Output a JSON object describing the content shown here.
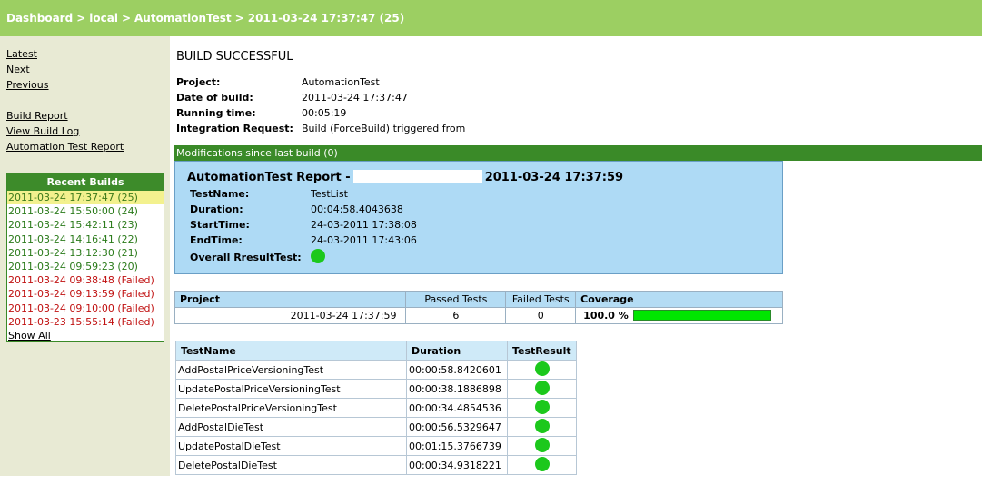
{
  "breadcrumb": {
    "dashboard": "Dashboard",
    "separator": ">",
    "server": "local",
    "project": "AutomationTest",
    "build": "2011-03-24 17:37:47 (25)"
  },
  "sidebar": {
    "nav": [
      "Latest",
      "Next",
      "Previous"
    ],
    "reports": [
      "Build Report",
      "View Build Log",
      "Automation Test Report"
    ],
    "recent_title": "Recent Builds",
    "recent_builds": [
      {
        "label": "2011-03-24 17:37:47 (25)",
        "state": "current"
      },
      {
        "label": "2011-03-24 15:50:00 (24)",
        "state": "ok"
      },
      {
        "label": "2011-03-24 15:42:11 (23)",
        "state": "ok"
      },
      {
        "label": "2011-03-24 14:16:41 (22)",
        "state": "ok"
      },
      {
        "label": "2011-03-24 13:12:30 (21)",
        "state": "ok"
      },
      {
        "label": "2011-03-24 09:59:23 (20)",
        "state": "ok"
      },
      {
        "label": "2011-03-24 09:38:48 (Failed)",
        "state": "fail"
      },
      {
        "label": "2011-03-24 09:13:59 (Failed)",
        "state": "fail"
      },
      {
        "label": "2011-03-24 09:10:00 (Failed)",
        "state": "fail"
      },
      {
        "label": "2011-03-23 15:55:14 (Failed)",
        "state": "fail"
      }
    ],
    "show_all": "Show All"
  },
  "build": {
    "status": "BUILD SUCCESSFUL",
    "project_label": "Project:",
    "project": "AutomationTest",
    "date_label": "Date of build:",
    "date": "2011-03-24 17:37:47",
    "running_label": "Running time:",
    "running": "00:05:19",
    "request_label": "Integration Request:",
    "request": "Build (ForceBuild) triggered from"
  },
  "modifications": "Modifications since last build (0)",
  "report": {
    "title_prefix": "AutomationTest Report -",
    "title_date": "2011-03-24 17:37:59",
    "testname_label": "TestName:",
    "testname": "TestList",
    "duration_label": "Duration:",
    "duration": "00:04:58.4043638",
    "start_label": "StartTime:",
    "start": "24-03-2011 17:38:08",
    "end_label": "EndTime:",
    "end": "24-03-2011 17:43:06",
    "overall_label": "Overall RresultTest:",
    "overall_status": "passed"
  },
  "coverage_table": {
    "headers": [
      "Project",
      "Passed Tests",
      "Failed Tests",
      "Coverage"
    ],
    "row": {
      "date": "2011-03-24 17:37:59",
      "passed": "6",
      "failed": "0",
      "coverage": "100.0 %",
      "coverage_fraction": 1.0
    }
  },
  "tests_table": {
    "headers": [
      "TestName",
      "Duration",
      "TestResult"
    ],
    "rows": [
      {
        "name": "AddPostalPriceVersioningTest",
        "duration": "00:00:58.8420601",
        "result": "passed"
      },
      {
        "name": "UpdatePostalPriceVersioningTest",
        "duration": "00:00:38.1886898",
        "result": "passed"
      },
      {
        "name": "DeletePostalPriceVersioningTest",
        "duration": "00:00:34.4854536",
        "result": "passed"
      },
      {
        "name": "AddPostalDieTest",
        "duration": "00:00:56.5329647",
        "result": "passed"
      },
      {
        "name": "UpdatePostalDieTest",
        "duration": "00:01:15.3766739",
        "result": "passed"
      },
      {
        "name": "DeletePostalDieTest",
        "duration": "00:00:34.9318221",
        "result": "passed"
      }
    ]
  },
  "colors": {
    "topbar": "#9ccf62",
    "green_bar": "#3a8a28",
    "pass_dot": "#1cc81c",
    "fail_text": "#c01010",
    "report_bg": "#aedaf5"
  }
}
